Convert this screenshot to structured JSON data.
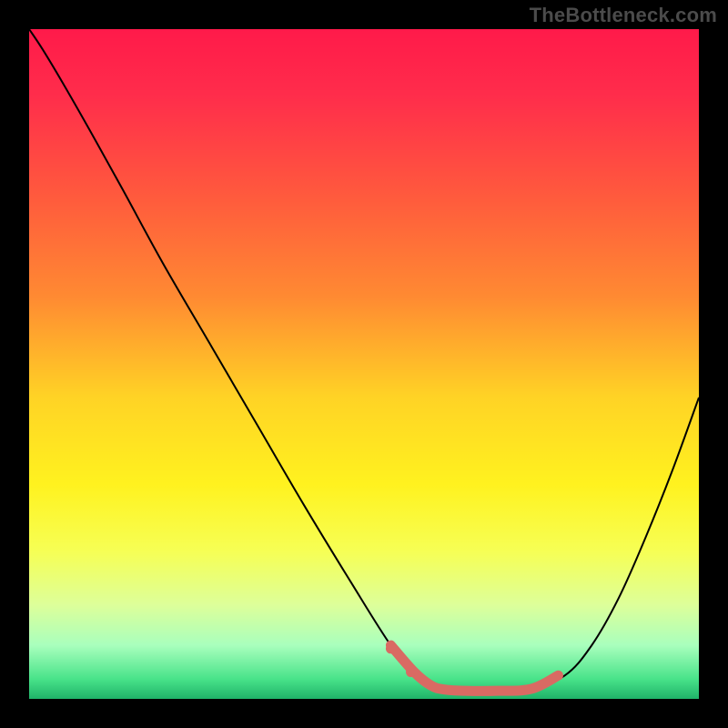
{
  "watermark": "TheBottleneck.com",
  "chart_data": {
    "type": "line",
    "title": "",
    "xlabel": "",
    "ylabel": "",
    "xlim": [
      0,
      100
    ],
    "ylim": [
      0,
      100
    ],
    "legend": false,
    "grid": false,
    "background": {
      "type": "vertical-gradient",
      "stops": [
        {
          "offset": 0.0,
          "color": "#ff1a4a"
        },
        {
          "offset": 0.1,
          "color": "#ff2d4b"
        },
        {
          "offset": 0.25,
          "color": "#ff5a3d"
        },
        {
          "offset": 0.4,
          "color": "#ff8a32"
        },
        {
          "offset": 0.55,
          "color": "#ffd325"
        },
        {
          "offset": 0.68,
          "color": "#fff21f"
        },
        {
          "offset": 0.78,
          "color": "#f6ff55"
        },
        {
          "offset": 0.86,
          "color": "#ddff9a"
        },
        {
          "offset": 0.92,
          "color": "#a9ffbd"
        },
        {
          "offset": 0.97,
          "color": "#49e38a"
        },
        {
          "offset": 1.0,
          "color": "#1fb369"
        }
      ]
    },
    "series": [
      {
        "name": "bottleneck-curve",
        "color": "#000000",
        "stroke_width": 2,
        "x": [
          0.0,
          2.0,
          5.0,
          9.0,
          14.0,
          20.0,
          27.0,
          34.0,
          41.0,
          48.0,
          54.0,
          57.5,
          60.0,
          62.0,
          65.0,
          70.0,
          75.0,
          80.0,
          84.0,
          88.0,
          92.0,
          96.0,
          100.0
        ],
        "y": [
          100.0,
          97.0,
          92.0,
          85.0,
          76.0,
          65.0,
          53.0,
          41.0,
          29.0,
          17.5,
          8.0,
          4.0,
          2.0,
          1.4,
          1.2,
          1.2,
          1.5,
          3.5,
          8.0,
          15.0,
          24.0,
          34.0,
          45.0
        ]
      },
      {
        "name": "highlight-segment",
        "color": "#d96a63",
        "stroke_width": 11,
        "linecap": "round",
        "x": [
          54.0,
          57.5,
          60.0,
          62.0,
          65.0,
          70.0,
          75.0,
          79.0
        ],
        "y": [
          8.0,
          4.0,
          2.0,
          1.4,
          1.2,
          1.2,
          1.5,
          3.5
        ]
      }
    ],
    "markers": [
      {
        "name": "highlight-dot-1",
        "x": 54.0,
        "y": 7.5,
        "r": 5.5,
        "color": "#d96a63"
      },
      {
        "name": "highlight-dot-2",
        "x": 57.0,
        "y": 4.0,
        "r": 5.5,
        "color": "#d96a63"
      }
    ]
  }
}
